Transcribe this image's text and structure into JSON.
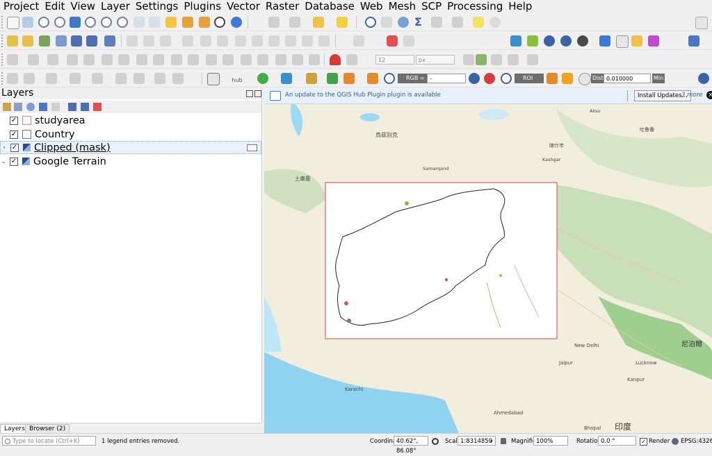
{
  "menu": [
    "Project",
    "Edit",
    "View",
    "Layer",
    "Settings",
    "Plugins",
    "Vector",
    "Raster",
    "Database",
    "Web",
    "Mesh",
    "SCP",
    "Processing",
    "Help"
  ],
  "toolbar": {
    "rgb_label": "RGB =",
    "rgb_value": "-",
    "roi_label": "ROI",
    "dist_label": "Dist",
    "dist_value": "0.010000",
    "min_label": "Min",
    "font_size": "12",
    "font_unit": "px",
    "hub_label": "hub"
  },
  "layers_panel": {
    "title": "Layers",
    "layers": [
      {
        "name": "studyarea",
        "checked": true,
        "symbol": "#f2a7a7"
      },
      {
        "name": "Country",
        "checked": true,
        "symbol": "#ffffff"
      },
      {
        "name": "Clipped (mask)",
        "checked": true,
        "symbol": "raster"
      },
      {
        "name": "Google Terrain",
        "checked": true,
        "symbol": "raster"
      }
    ],
    "tabs": [
      "Layers",
      "Browser (2)"
    ]
  },
  "message_bar": {
    "text": "An update to the QGIS Hub Plugin plugin is available",
    "button": "Install Updates…",
    "more": "3 more"
  },
  "map_labels": [
    "烏兹别克",
    "Samarqand",
    "土庫曼",
    "吐鲁番",
    "喀什市",
    "Aksu",
    "Kashgar",
    "New Delhi",
    "Jaipur",
    "Lucknow",
    "Kanpur",
    "Bhopal",
    "印度",
    "尼泊爾",
    "Ahmedabad",
    "Karachi"
  ],
  "status": {
    "locate_placeholder": "Type to locate (Ctrl+K)",
    "message": "1 legend entries removed.",
    "coordinate_label": "Coordinate",
    "coordinate_value": "40.62°, 86.08°",
    "scale_label": "Scale",
    "scale_value": "1:8314850",
    "magnifier_label": "Magnifier",
    "magnifier_value": "100%",
    "rotation_label": "Rotation",
    "rotation_value": "0.0 °",
    "render_label": "Render",
    "crs": "EPSG:4326"
  },
  "colors": {
    "study_area_border": "#e04040",
    "water": "#8dd0f0",
    "terrain_green": "#c5dfb8",
    "desert": "#f3ede0",
    "accent": "#1e6fc9"
  }
}
